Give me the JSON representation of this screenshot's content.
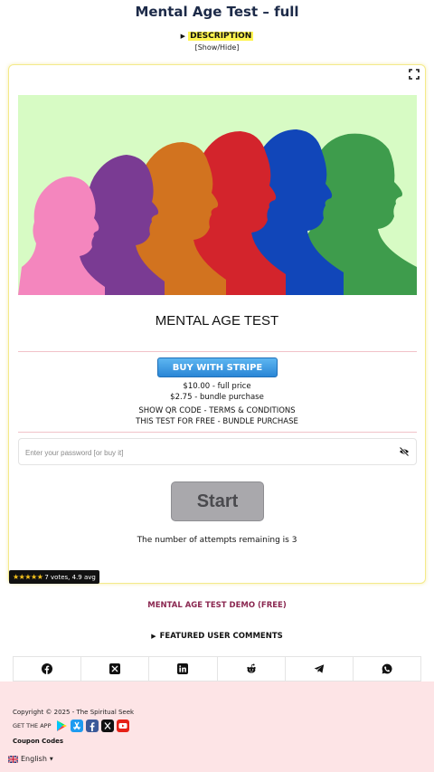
{
  "page": {
    "title": "Mental Age Test – full"
  },
  "description": {
    "toggle_label": "DESCRIPTION",
    "show_hide": "[Show/Hide]"
  },
  "test": {
    "heading": "MENTAL AGE TEST",
    "buy_button": "BUY WITH STRIPE",
    "price_full": "$10.00 - full price",
    "price_bundle": "$2.75 - bundle purchase",
    "qr_terms": "SHOW QR CODE - TERMS & CONDITIONS",
    "free_bundle": "THIS TEST FOR FREE - BUNDLE PURCHASE",
    "password_placeholder": "Enter your password [or buy it]",
    "start_button": "Start",
    "attempts": "The number of attempts remaining is 3",
    "rating_stars": "★★★★★",
    "rating_text": "7 votes, 4.9 avg"
  },
  "links": {
    "demo": "MENTAL AGE TEST DEMO (FREE)",
    "comments": "FEATURED USER COMMENTS"
  },
  "share": [
    {
      "icon": "facebook-icon"
    },
    {
      "icon": "x-icon"
    },
    {
      "icon": "linkedin-icon"
    },
    {
      "icon": "reddit-icon"
    },
    {
      "icon": "telegram-icon"
    },
    {
      "icon": "whatsapp-icon"
    }
  ],
  "footer": {
    "copyright": "Copyright © 2025 - The Spiritual Seek",
    "get_app": "GET THE APP",
    "coupon": "Coupon Codes",
    "language": "English"
  },
  "colors": {
    "title": "#1c2a48",
    "hero_background": "#d7fbc4",
    "stripe_button": "#2a86d6",
    "demo_link": "#8a2750",
    "footer_background": "#fde4e6",
    "silhouettes": [
      "#f486be",
      "#7a3b93",
      "#d2731f",
      "#d3242c",
      "#1146b9",
      "#3e9c4c"
    ]
  }
}
